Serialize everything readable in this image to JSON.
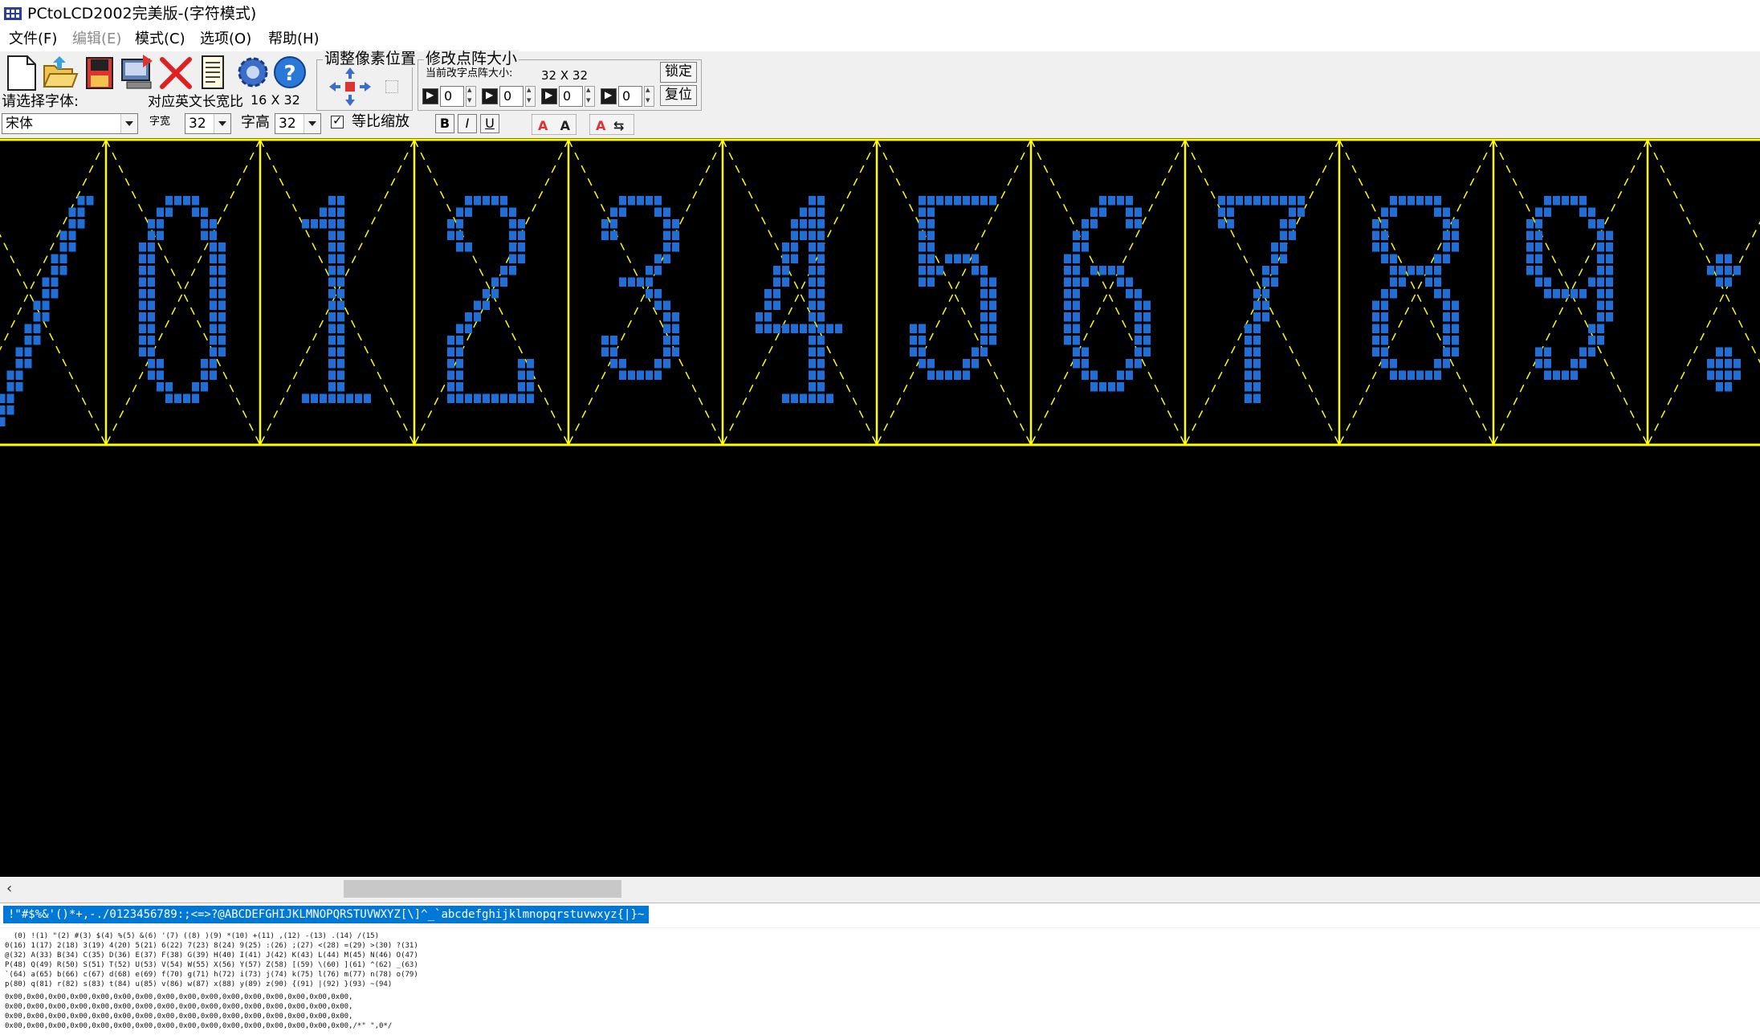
{
  "window": {
    "title": "PCtoLCD2002完美版-(字符模式)"
  },
  "menu": [
    {
      "label": "文件(F)",
      "enabled": true
    },
    {
      "label": "编辑(E)",
      "enabled": false
    },
    {
      "label": "模式(C)",
      "enabled": true
    },
    {
      "label": "选项(O)",
      "enabled": true
    },
    {
      "label": "帮助(H)",
      "enabled": true
    }
  ],
  "toolbar": {
    "icons": [
      "new-file-icon",
      "open-folder-icon",
      "save-icon",
      "export-icon",
      "delete-icon",
      "document-icon",
      "settings-gear-icon",
      "help-icon"
    ],
    "font_label": "请选择字体:",
    "ratio_label": "对应英文长宽比",
    "ratio_value": "16 X 32",
    "adjust_position_title": "调整像素位置",
    "modify_matrix_title": "修改点阵大小",
    "current_matrix_label": "当前改字点阵大小:",
    "current_matrix_value": "32 X 32",
    "lock_button": "锁定",
    "reset_button": "复位",
    "offsets": [
      "0",
      "0",
      "0",
      "0"
    ],
    "font_name": "宋体",
    "char_width_label": "字宽",
    "char_width": "32",
    "char_height_label": "字高",
    "char_height": "32",
    "proportional_label": "等比缩放",
    "proportional_checked": true,
    "bold": "B",
    "italic": "I",
    "underline": "U"
  },
  "canvas": {
    "background": "#000000",
    "pixel_color": "#1f6fd6",
    "grid_color": "#ffff00",
    "characters": [
      "/",
      "0",
      "1",
      "2",
      "3",
      "4",
      "5",
      "6",
      "7",
      "8",
      "9",
      ":"
    ]
  },
  "input_text": " !\"#$%&'()*+,-./0123456789:;<=>?@ABCDEFGHIJKLMNOPQRSTUVWXYZ[\\]^_`abcdefghijklmnopqrstuvwxyz{|}~",
  "output_lines": [
    "  (0) !(1) \"(2) #(3) $(4) %(5) &(6) '(7) ((8) )(9) *(10) +(11) ,(12) -(13) .(14) /(15)",
    "0(16) 1(17) 2(18) 3(19) 4(20) 5(21) 6(22) 7(23) 8(24) 9(25) :(26) ;(27) <(28) =(29) >(30) ?(31)",
    "@(32) A(33) B(34) C(35) D(36) E(37) F(38) G(39) H(40) I(41) J(42) K(43) L(44) M(45) N(46) O(47)",
    "P(48) Q(49) R(50) S(51) T(52) U(53) V(54) W(55) X(56) Y(57) Z(58) [(59) \\(60) ](61) ^(62) _(63)",
    "`(64) a(65) b(66) c(67) d(68) e(69) f(70) g(71) h(72) i(73) j(74) k(75) l(76) m(77) n(78) o(79)",
    "p(80) q(81) r(82) s(83) t(84) u(85) v(86) w(87) x(88) y(89) z(90) {(91) |(92) }(93) ~(94)",
    "",
    "0x00,0x00,0x00,0x00,0x00,0x00,0x00,0x00,0x00,0x00,0x00,0x00,0x00,0x00,0x00,0x00,",
    "0x00,0x00,0x00,0x00,0x00,0x00,0x00,0x00,0x00,0x00,0x00,0x00,0x00,0x00,0x00,0x00,",
    "0x00,0x00,0x00,0x00,0x00,0x00,0x00,0x00,0x00,0x00,0x00,0x00,0x00,0x00,0x00,0x00,",
    "0x00,0x00,0x00,0x00,0x00,0x00,0x00,0x00,0x00,0x00,0x00,0x00,0x00,0x00,0x00,0x00,/*\" \",0*/"
  ]
}
